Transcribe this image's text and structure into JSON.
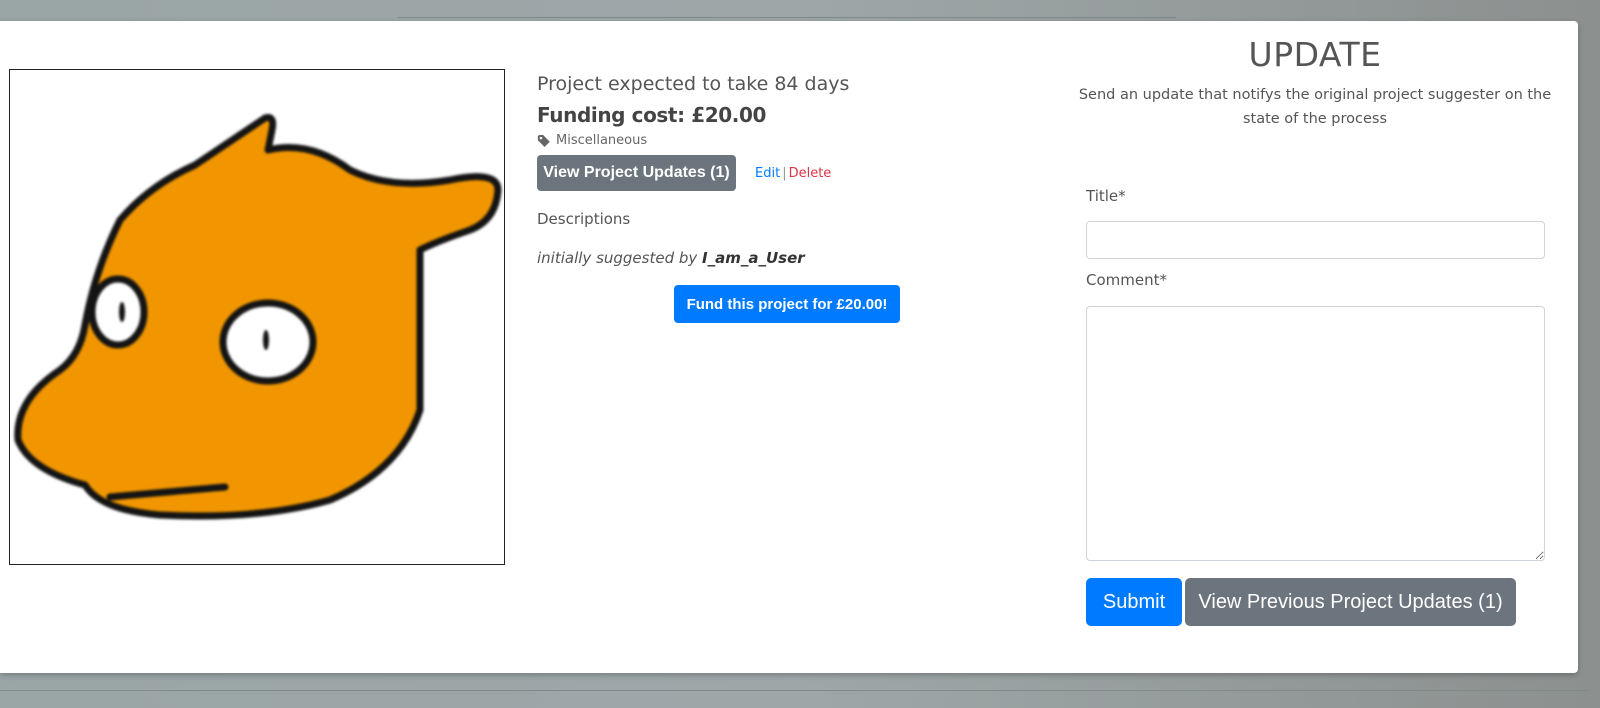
{
  "project": {
    "duration_text": "Project expected to take 84 days",
    "cost_text": "Funding cost: £20.00",
    "tag_icon": "tag-icon",
    "category": "Miscellaneous",
    "view_updates_label": "View Project Updates (1)",
    "edit_label": "Edit",
    "separator": "|",
    "delete_label": "Delete",
    "descriptions_label": "Descriptions",
    "suggested_prefix": "initially suggested by ",
    "suggested_user": "I_am_a_User",
    "fund_label": "Fund this project for £20.00!"
  },
  "update_form": {
    "heading": "UPDATE",
    "subtitle": "Send an update that notifys the original project suggester on the state of the process",
    "title_label": "Title*",
    "title_value": "",
    "comment_label": "Comment*",
    "comment_value": "",
    "submit_label": "Submit",
    "previous_label": "View Previous Project Updates (1)"
  },
  "colors": {
    "primary": "#007bff",
    "secondary": "#6c757d",
    "danger": "#dc3545",
    "creature_fill": "#f19600"
  }
}
